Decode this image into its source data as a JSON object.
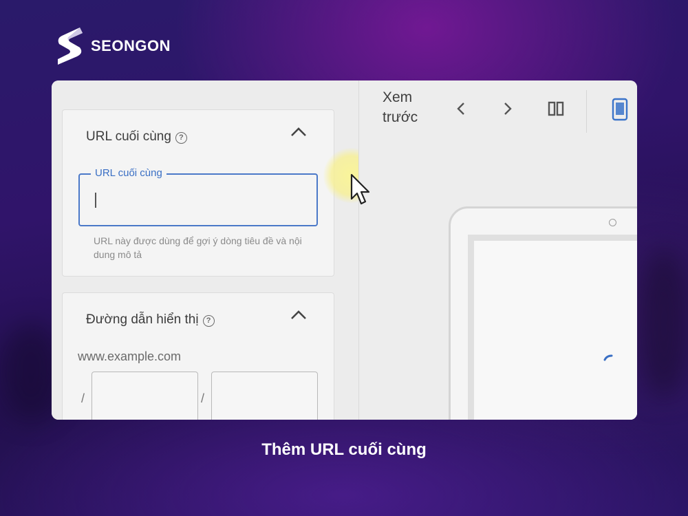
{
  "brand": {
    "name": "SEONGON",
    "icon": "seongon-logo-icon"
  },
  "left_panel": {
    "final_url_section": {
      "title": "URL cuối cùng",
      "help_icon": "help-circle-icon",
      "help_symbol": "?",
      "collapse_icon": "chevron-up-icon",
      "field": {
        "label": "URL cuối cùng",
        "value": ""
      },
      "helper_text": "URL này được dùng để gợi ý dòng tiêu đề và nội dung mô tả"
    },
    "display_path_section": {
      "title": "Đường dẫn hiển thị",
      "help_icon": "help-circle-icon",
      "help_symbol": "?",
      "collapse_icon": "chevron-up-icon",
      "domain": "www.example.com",
      "separator": "/",
      "path1_value": "",
      "path2_value": ""
    }
  },
  "preview_toolbar": {
    "label": "Xem trước",
    "icons": [
      "chevron-left-icon",
      "chevron-right-icon",
      "split-view-icon",
      "mobile-phone-icon"
    ]
  },
  "caption": "Thêm URL cuối cùng",
  "colors": {
    "accent_blue": "#4a78c8",
    "highlight_yellow": "#f5ec8a",
    "caption_text": "#ffffff"
  }
}
